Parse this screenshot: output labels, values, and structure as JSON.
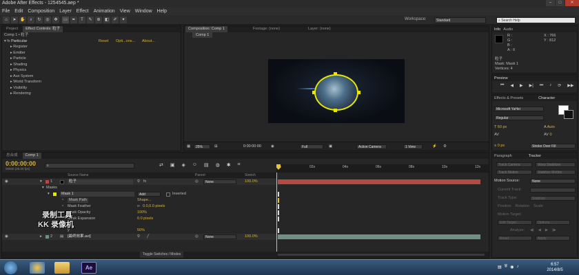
{
  "window": {
    "title": "Adobe After Effects - 1254545.aep *",
    "min": "–",
    "max": "□",
    "close": "✕"
  },
  "menu": [
    "File",
    "Edit",
    "Composition",
    "Layer",
    "Effect",
    "Animation",
    "View",
    "Window",
    "Help"
  ],
  "toolbar": {
    "workspace_label": "Workspace:",
    "workspace_value": "Standard",
    "search_placeholder": "Search Help"
  },
  "project_panel": {
    "tabs": [
      "Project",
      "Effect Controls: 粒子"
    ],
    "header": "Comp 1 • 粒子",
    "effect_name": "Particular",
    "reset": "Reset",
    "options": "Opti...ons...",
    "about": "About...",
    "groups": [
      "Register",
      "Emitter",
      "Particle",
      "Shading",
      "Physics",
      "Aux System",
      "World Transform",
      "Visibility",
      "Rendering"
    ]
  },
  "viewer": {
    "tabs": [
      "Composition: Comp 1",
      "Footage: (none)",
      "Layer: (none)"
    ],
    "subtab": "Comp 1",
    "zoom": "25%",
    "timecode": "0:00:00:00",
    "resolution": "Full",
    "camera": "Active Camera",
    "view": "1 View"
  },
  "info_panel": {
    "tabs": [
      "Info",
      "Audio"
    ],
    "r": "R :",
    "g": "G :",
    "b": "B :",
    "a": "A : 0",
    "x": "X : 766",
    "y": "Y : 812",
    "layer": "粒子",
    "mask": "Mask: Mask 1",
    "vertices": "Vertices: 4"
  },
  "preview_panel": {
    "title": "Preview"
  },
  "effects_panel": {
    "tabs": [
      "Effects & Presets",
      "Character"
    ]
  },
  "character_panel": {
    "font": "Microsoft YaHei",
    "style": "Regular",
    "size": "60 px",
    "leading": "Auto",
    "tracking": "0",
    "stroke_width": "0 px",
    "stroke_mode": "Stroke Over Fill"
  },
  "tracker_panel": {
    "tabs": [
      "Paragraph",
      "Tracker"
    ],
    "buttons": [
      "Track Camera",
      "Warp Stabilizer",
      "Track Motion",
      "Stabilize Motion"
    ],
    "motion_source_label": "Motion Source:",
    "motion_source_value": "None",
    "current_track": "Current Track:",
    "track_type": "Track Type:",
    "track_type_value": "Stabilize",
    "position": "Position",
    "rotation": "Rotation",
    "scale": "Scale",
    "motion_target": "Motion Target:",
    "edit_target": "Edit Target...",
    "options": "Options...",
    "analyze": "Analyze:",
    "reset": "Reset",
    "apply": "Apply"
  },
  "timeline": {
    "tabs": [
      "总合成",
      "Comp 1"
    ],
    "timecode": "0:00:00:00",
    "fps": "00000 (25.00 fps)",
    "columns": {
      "source": "Source Name",
      "parent": "Parent",
      "stretch": "Stretch"
    },
    "ruler": [
      "0s",
      "02s",
      "04s",
      "06s",
      "08s",
      "10s",
      "12s"
    ],
    "rows": [
      {
        "num": "1",
        "name": "粒子",
        "parent": "None",
        "stretch": "100.0%"
      },
      {
        "name": "Masks"
      },
      {
        "name": "Mask 1",
        "mode": "Add",
        "inverted": "Inverted"
      },
      {
        "name": "Mask Path",
        "value": "Shape..."
      },
      {
        "name": "Mask Feather",
        "value": "0.0,0.0 pixels"
      },
      {
        "name": "Mask Opacity",
        "value": "100%"
      },
      {
        "name": "Mask Expansion",
        "value": "0.0 pixels"
      },
      {
        "name": "y",
        "value": "50%"
      },
      {
        "num": "2",
        "name": "[最终效果.avi]",
        "parent": "None",
        "stretch": "100.0%"
      }
    ],
    "toggle_label": "Toggle Switches / Modes"
  },
  "watermark": {
    "line1": "录制工具",
    "line2": "KK 录像机"
  },
  "taskbar": {
    "ae_label": "Ae",
    "time": "6:57",
    "date": "2014/8/5"
  },
  "colors": {
    "accent": "#d8b23a",
    "layer_bar": "#b54a45",
    "layer2_bar": "#6f8f87",
    "mask": "#e8e800"
  }
}
